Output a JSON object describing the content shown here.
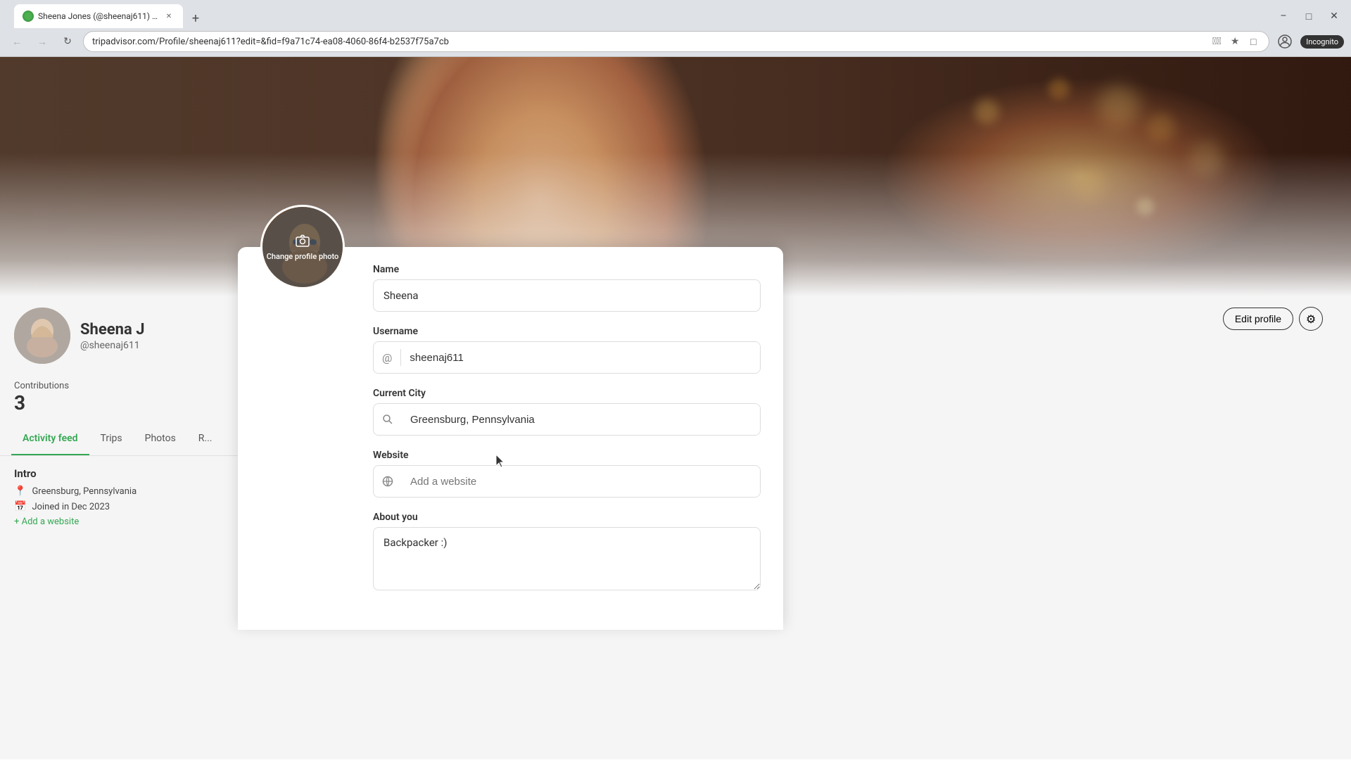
{
  "browser": {
    "tab_title": "Sheena Jones (@sheenaj611) - T...",
    "url": "tripadvisor.com/Profile/sheenaj611?edit=&fid=f9a71c74-ea08-4060-86f4-b2537f75a7cb",
    "incognito_label": "Incognito",
    "new_tab_label": "+"
  },
  "profile": {
    "name": "Sheena J",
    "full_name_display": "Sheena J",
    "username": "@sheenaj611",
    "contributions_label": "Contributions",
    "contributions_count": "3",
    "location": "Greensburg, Pennsylvania",
    "joined": "Joined in Dec 2023",
    "add_website_label": "+ Add a website"
  },
  "nav_tabs": [
    {
      "label": "Activity feed",
      "active": true
    },
    {
      "label": "Trips",
      "active": false
    },
    {
      "label": "Photos",
      "active": false
    },
    {
      "label": "R...",
      "active": false
    }
  ],
  "edit_panel": {
    "avatar_label": "Change profile photo",
    "name_label": "Name",
    "name_value": "Sheena",
    "username_label": "Username",
    "username_value": "sheenaj611",
    "username_prefix": "@",
    "city_label": "Current City",
    "city_value": "Greensburg, Pennsylvania",
    "website_label": "Website",
    "website_placeholder": "Add a website",
    "about_label": "About you",
    "about_value": "Backpacker :)"
  },
  "header_buttons": {
    "edit_profile": "Edit profile"
  },
  "intro": {
    "title": "Intro",
    "location": "Greensburg, Pennsylvania",
    "joined": "Joined in Dec 2023",
    "add_website": "+ Add a website"
  }
}
